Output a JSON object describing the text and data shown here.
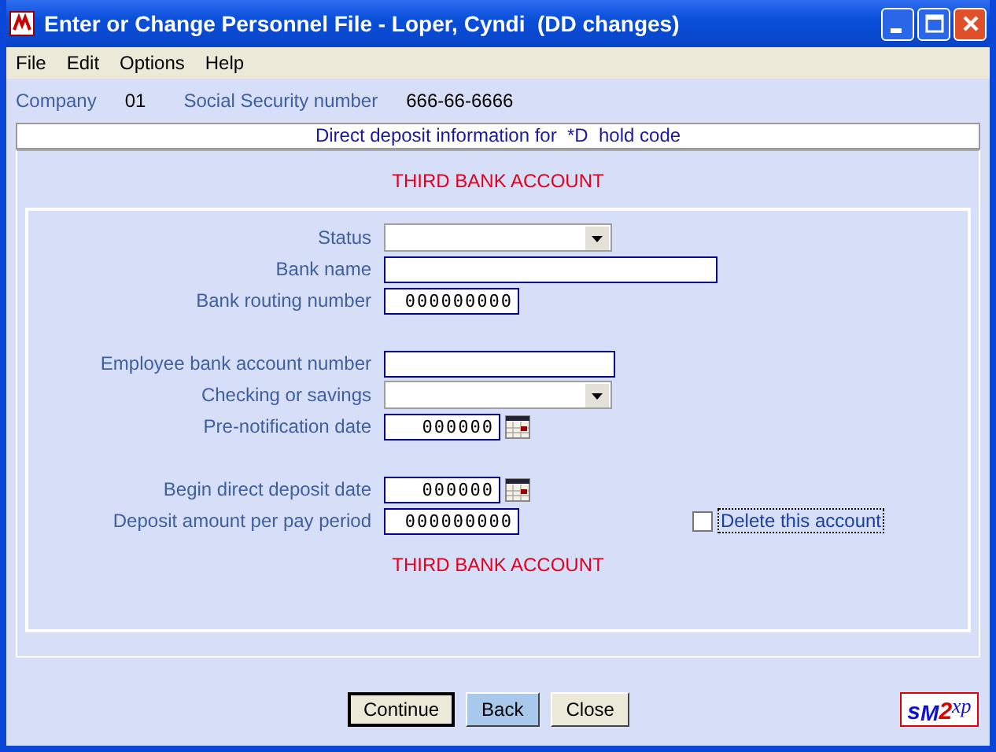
{
  "window": {
    "title": "Enter or Change Personnel File - Loper, Cyndi  (DD changes)"
  },
  "menu": [
    "File",
    "Edit",
    "Options",
    "Help"
  ],
  "header": {
    "company_label": "Company",
    "company": "01",
    "ssn_label": "Social Security number",
    "ssn": "666-66-6666"
  },
  "banner": "Direct deposit information for  *D  hold code",
  "heading_top": "THIRD BANK ACCOUNT",
  "field_groups": [
    [
      {
        "label": "Status",
        "kind": "dropdown"
      },
      {
        "label": "Bank name",
        "kind": "text"
      },
      {
        "label": "Bank routing number",
        "kind": "number",
        "value": "000000000"
      }
    ],
    [
      {
        "label": "Employee bank account number",
        "kind": "text"
      },
      {
        "label": "Checking or savings",
        "kind": "dropdown"
      },
      {
        "label": "Pre-notification date",
        "kind": "date",
        "value": "000000"
      }
    ],
    [
      {
        "label": "Begin direct deposit date",
        "kind": "date",
        "value": "000000"
      },
      {
        "label": "Deposit amount per pay period",
        "kind": "number",
        "value": "000000000"
      }
    ]
  ],
  "delete_checkbox": {
    "label": "Delete this account",
    "checked": false
  },
  "heading_bottom": "THIRD BANK ACCOUNT",
  "buttons": [
    {
      "label": "Continue",
      "selected": false
    },
    {
      "label": "Back",
      "selected": true
    },
    {
      "label": "Close",
      "selected": false
    }
  ],
  "logo": [
    "s",
    "M",
    "2",
    "xp"
  ]
}
